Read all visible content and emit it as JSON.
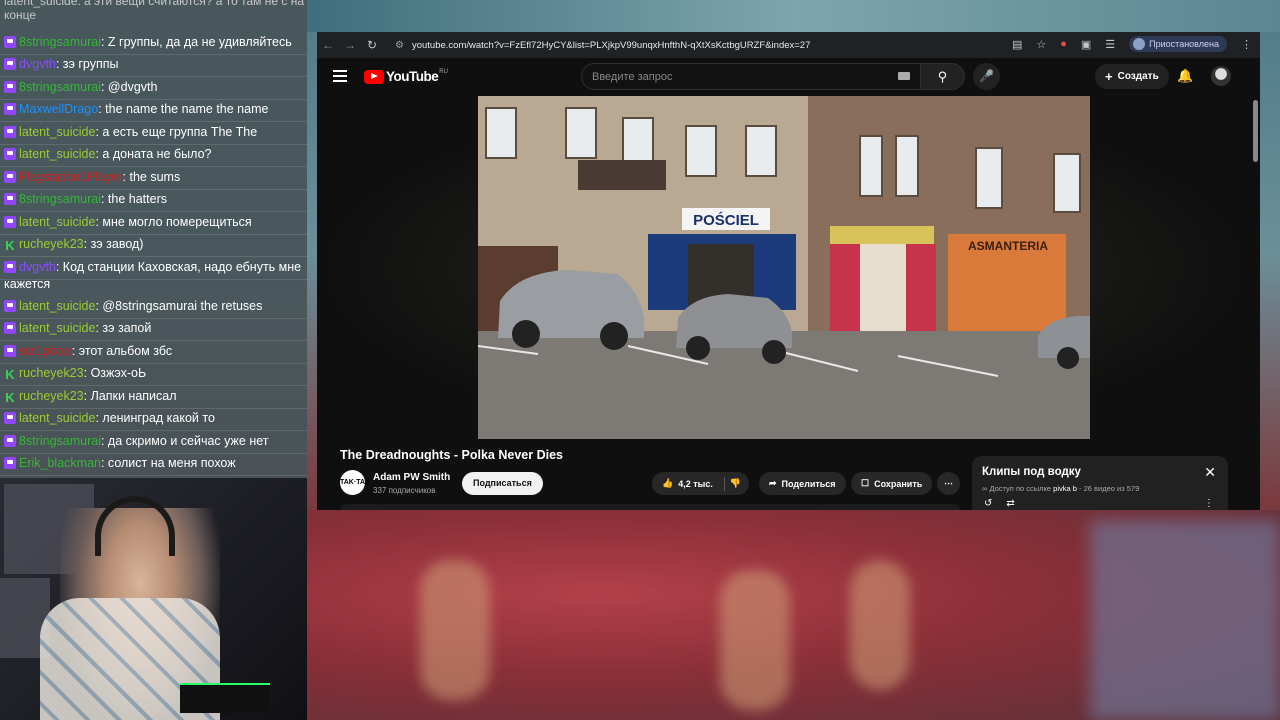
{
  "chat": {
    "top_cut": "latent_suicide: а эти вещи считаются? а то там не с на",
    "top_cut_end": "конце",
    "messages": [
      {
        "badge": "purple",
        "user": "8stringsamurai",
        "color": "#35b736",
        "text": ": Z группы, да да не удивляйтесь"
      },
      {
        "badge": "purple",
        "user": "dvgvth",
        "color": "#8a4fff",
        "text": ": зэ группы"
      },
      {
        "badge": "purple",
        "user": "8stringsamurai",
        "color": "#35b736",
        "text": ": @dvgvth"
      },
      {
        "badge": "purple",
        "user": "MaxwellDrago",
        "color": "#1e90ff",
        "text": ": the name the name the name"
      },
      {
        "badge": "purple",
        "user": "latent_suicide",
        "color": "#9acd32",
        "text": ": а есть еще группа The The"
      },
      {
        "badge": "purple",
        "user": "latent_suicide",
        "color": "#9acd32",
        "text": ": а доната не было?"
      },
      {
        "badge": "purple",
        "user": "Playstation1Player",
        "color": "#d11f1f",
        "text": ": the sums"
      },
      {
        "badge": "purple",
        "user": "8stringsamurai",
        "color": "#35b736",
        "text": ": the hatters"
      },
      {
        "badge": "purple",
        "user": "latent_suicide",
        "color": "#9acd32",
        "text": ": мне могло померещиться"
      },
      {
        "badge": "green",
        "user": "rucheyek23",
        "color": "#9acd32",
        "text": ": зэ завод)"
      },
      {
        "badge": "purple",
        "user": "dvgvth",
        "color": "#8a4fff",
        "text": ": Код станции Каховская, надо ебнуть мне кажется"
      },
      {
        "badge": "purple",
        "user": "latent_suicide",
        "color": "#9acd32",
        "text": ": @8stringsamurai the retuses"
      },
      {
        "badge": "purple",
        "user": "latent_suicide",
        "color": "#9acd32",
        "text": ": зэ запой"
      },
      {
        "badge": "purple",
        "user": "scr1ptxxx",
        "color": "#d11f1f",
        "text": ": этот альбом збс"
      },
      {
        "badge": "green",
        "user": "rucheyek23",
        "color": "#9acd32",
        "text": ": Озжэх-оЬ"
      },
      {
        "badge": "green",
        "user": "rucheyek23",
        "color": "#9acd32",
        "text": ": Лапки написал"
      },
      {
        "badge": "purple",
        "user": "latent_suicide",
        "color": "#9acd32",
        "text": ": ленинград какой то"
      },
      {
        "badge": "purple",
        "user": "8stringsamurai",
        "color": "#35b736",
        "text": ": да скримо и сейчас уже нет"
      },
      {
        "badge": "purple",
        "user": "Erik_blackman",
        "color": "#35b736",
        "text": ": солист на меня похож"
      }
    ]
  },
  "browser": {
    "url": "youtube.com/watch?v=FzEfl72HyCY&list=PLXjkpV99unqxHnfthN-qXtXsKctbgURZF&index=27",
    "paused_label": "Приостановлена"
  },
  "youtube": {
    "logo_text": "YouTube",
    "region": "RU",
    "search_placeholder": "Введите запрос",
    "create_label": "Создать",
    "video_title": "The Dreadnoughts - Polka Never Dies",
    "channel_name": "Adam PW Smith",
    "channel_avatar_text": "TAK·TAK",
    "channel_subs": "337 подписчиков",
    "subscribe_label": "Подписаться",
    "likes": "4,2 тыс.",
    "share_label": "Поделиться",
    "save_label": "Сохранить",
    "shop_signs": [
      "POŚCIEL",
      "ASMANTERIA"
    ],
    "playlist": {
      "title": "Клипы под водку",
      "access": "Доступ по ссылке",
      "owner": "pivka b",
      "position": "- 26 видео из 579"
    }
  },
  "colors": {
    "twitch_purple": "#9146ff",
    "yt_red": "#ff0000",
    "yt_bg": "#0f0f0f"
  }
}
